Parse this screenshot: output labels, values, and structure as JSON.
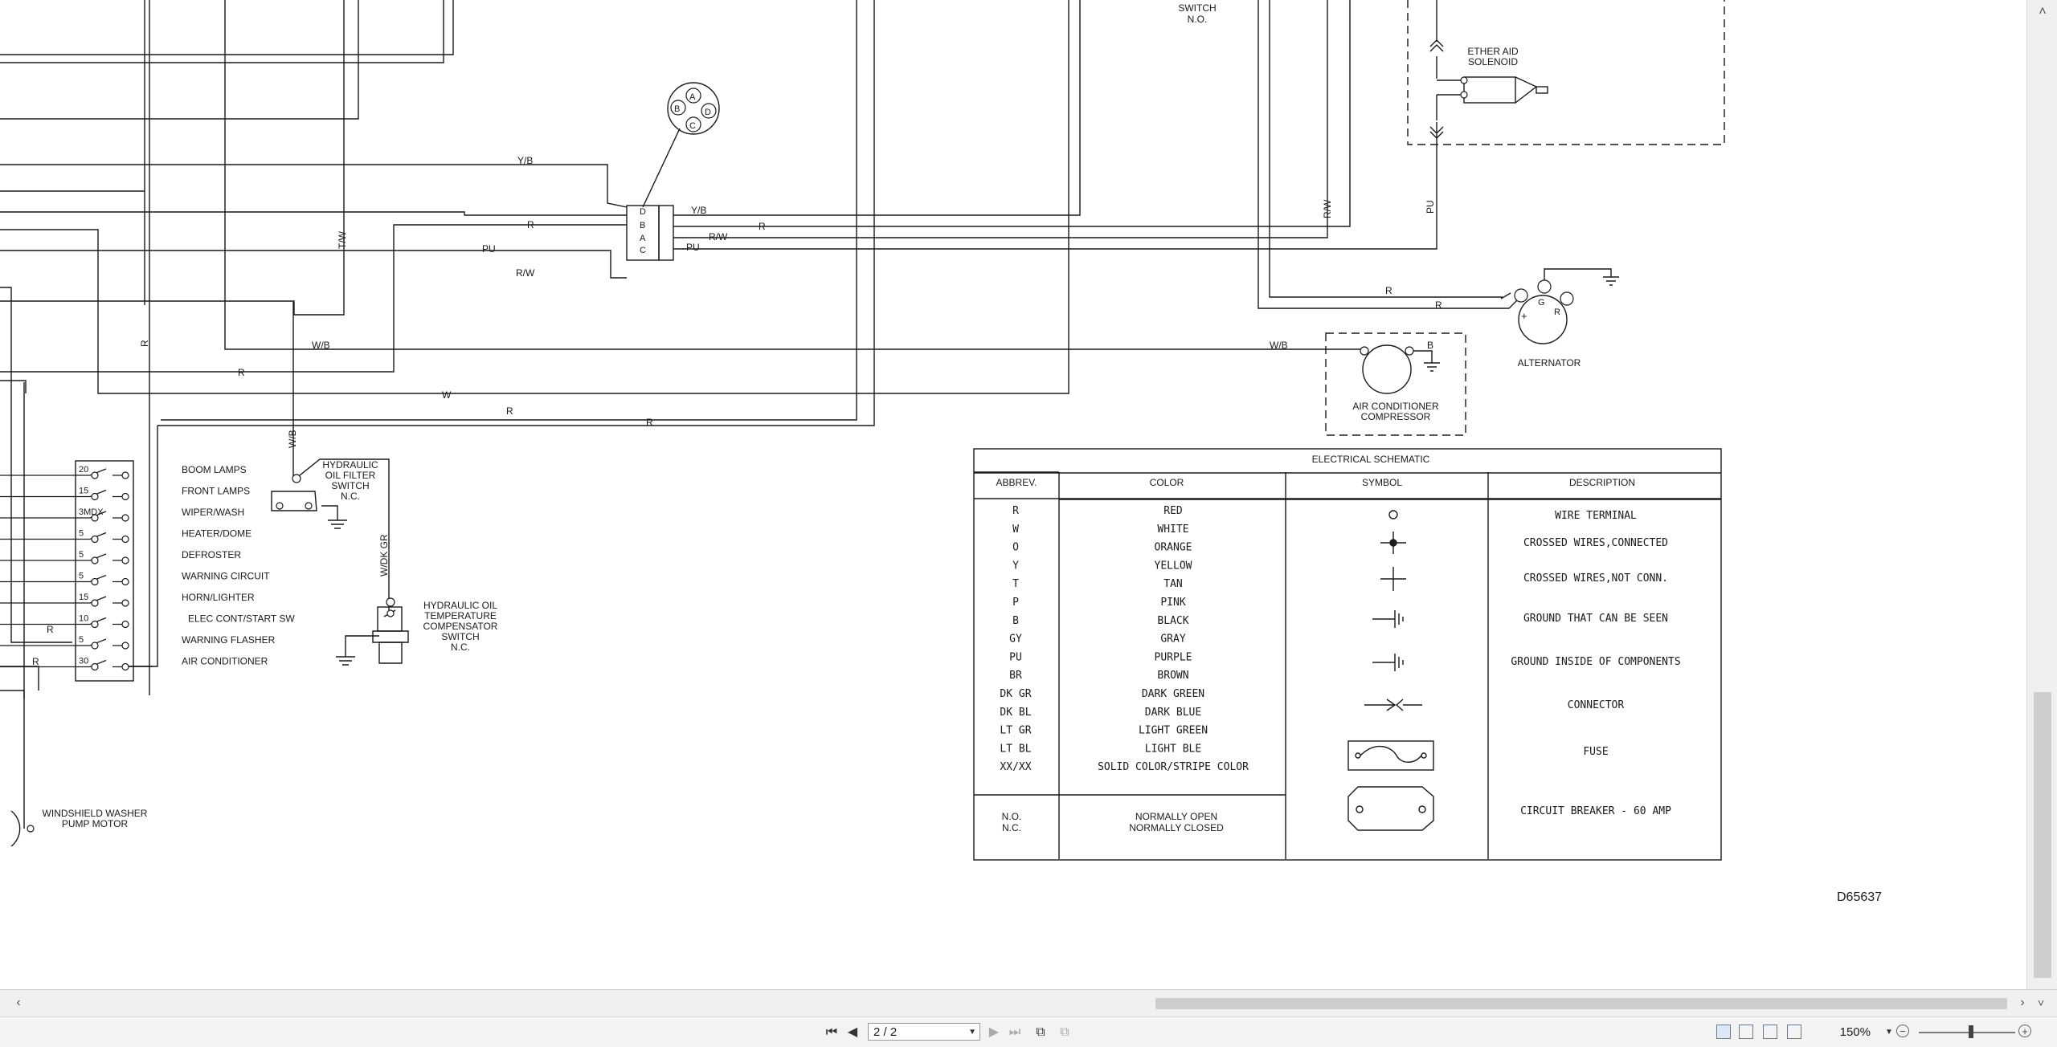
{
  "labels": {
    "switch_top": [
      "SWITCH",
      "N.O."
    ],
    "ether_aid": [
      "ETHER AID",
      "SOLENOID"
    ],
    "alternator": "ALTERNATOR",
    "ac_compressor": [
      "AIR CONDITIONER",
      "COMPRESSOR"
    ],
    "hyd_filter": [
      "HYDRAULIC",
      "OIL FILTER",
      "SWITCH",
      "N.C."
    ],
    "hyd_temp": [
      "HYDRAULIC OIL",
      "TEMPERATURE",
      "COMPENSATOR",
      "SWITCH",
      "N.C."
    ],
    "washer_motor": [
      "WINDSHIELD WASHER",
      "PUMP MOTOR"
    ],
    "drawing_number": "D65637"
  },
  "connector_pins": [
    "D",
    "B",
    "A",
    "C"
  ],
  "round_connector_pins": [
    "A",
    "B",
    "D",
    "C"
  ],
  "alternator_terminals": [
    "G",
    "R",
    "+"
  ],
  "wire_labels": {
    "yb1": "Y/B",
    "yb2": "Y/B",
    "r1": "R",
    "r2": "R",
    "pu1": "PU",
    "pu2": "PU",
    "rw1": "R/W",
    "rw2": "R/W",
    "rw_vert": "R/W",
    "pu_vert": "PU",
    "tw": "T/W",
    "wb1": "W/B",
    "wb2": "W/B",
    "wb_vert": "W/B",
    "r3": "R",
    "w1": "W",
    "r4": "R",
    "r5": "R",
    "r_alt1": "R",
    "r_alt2": "R",
    "b_ac": "B",
    "r_left": "R",
    "r_fuse1": "R",
    "r_fuse2": "R",
    "wdkgr": "W/DK GR"
  },
  "fuses": [
    {
      "amp": "20",
      "name": "BOOM LAMPS"
    },
    {
      "amp": "15",
      "name": "FRONT LAMPS"
    },
    {
      "amp": "3MDX",
      "name": "WIPER/WASH"
    },
    {
      "amp": "5",
      "name": "HEATER/DOME"
    },
    {
      "amp": "5",
      "name": "DEFROSTER"
    },
    {
      "amp": "5",
      "name": "WARNING CIRCUIT"
    },
    {
      "amp": "15",
      "name": "HORN/LIGHTER"
    },
    {
      "amp": "10",
      "name": "ELEC CONT/START SW"
    },
    {
      "amp": "5",
      "name": "WARNING FLASHER"
    },
    {
      "amp": "30",
      "name": "AIR CONDITIONER"
    }
  ],
  "legend": {
    "title": "ELECTRICAL SCHEMATIC",
    "headers": {
      "abbrev": "ABBREV.",
      "color": "COLOR",
      "symbol": "SYMBOL",
      "description": "DESCRIPTION"
    },
    "colors": [
      {
        "abbrev": "R",
        "color": "RED"
      },
      {
        "abbrev": "W",
        "color": "WHITE"
      },
      {
        "abbrev": "O",
        "color": "ORANGE"
      },
      {
        "abbrev": "Y",
        "color": "YELLOW"
      },
      {
        "abbrev": "T",
        "color": "TAN"
      },
      {
        "abbrev": "P",
        "color": "PINK"
      },
      {
        "abbrev": "B",
        "color": "BLACK"
      },
      {
        "abbrev": "GY",
        "color": "GRAY"
      },
      {
        "abbrev": "PU",
        "color": "PURPLE"
      },
      {
        "abbrev": "BR",
        "color": "BROWN"
      },
      {
        "abbrev": "DK GR",
        "color": "DARK GREEN"
      },
      {
        "abbrev": "DK BL",
        "color": "DARK BLUE"
      },
      {
        "abbrev": "LT GR",
        "color": "LIGHT GREEN"
      },
      {
        "abbrev": "LT BL",
        "color": "LIGHT BLE"
      },
      {
        "abbrev": "XX/XX",
        "color": "SOLID COLOR/STRIPE COLOR"
      }
    ],
    "states": {
      "abbrev": [
        "N.O.",
        "N.C."
      ],
      "meaning": [
        "NORMALLY OPEN",
        "NORMALLY CLOSED"
      ]
    },
    "symbols": [
      {
        "icon": "wire-terminal-icon",
        "description": "WIRE TERMINAL"
      },
      {
        "icon": "crossed-wires-connected-icon",
        "description": "CROSSED WIRES,CONNECTED"
      },
      {
        "icon": "crossed-wires-not-connected-icon",
        "description": "CROSSED WIRES,NOT CONN."
      },
      {
        "icon": "ground-visible-icon",
        "description": "GROUND THAT CAN BE SEEN"
      },
      {
        "icon": "ground-inside-icon",
        "description": "GROUND INSIDE OF COMPONENTS"
      },
      {
        "icon": "connector-icon",
        "description": "CONNECTOR"
      },
      {
        "icon": "fuse-icon",
        "description": "FUSE"
      },
      {
        "icon": "circuit-breaker-icon",
        "description": "CIRCUIT BREAKER - 60 AMP"
      }
    ]
  },
  "viewer": {
    "page_input": "2 / 2",
    "zoom": "150%"
  },
  "colors": {
    "line": "#1a1a1a",
    "chrome": "#f0f0f0",
    "thumb": "#cdcdcd"
  }
}
